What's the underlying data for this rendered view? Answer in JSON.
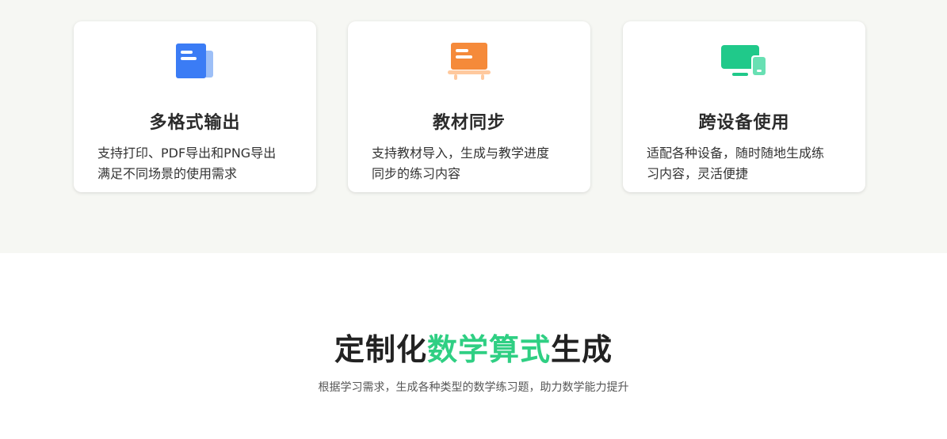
{
  "features": [
    {
      "icon": "document-copy-icon",
      "title": "多格式输出",
      "desc_lines": [
        "支持打印、PDF导出和PNG导出",
        "满足不同场景的使用需求"
      ]
    },
    {
      "icon": "blackboard-icon",
      "title": "教材同步",
      "desc_lines": [
        "支持教材导入，生成与教学进度",
        "同步的练习内容"
      ]
    },
    {
      "icon": "devices-icon",
      "title": "跨设备使用",
      "desc_lines": [
        "适配各种设备，随时随地生成练",
        "习内容，灵活便捷"
      ]
    }
  ],
  "section": {
    "title_pre": "定制化",
    "title_accent": "数学算式",
    "title_post": "生成",
    "subtitle": "根据学习需求，生成各种类型的数学练习题，助力数学能力提升"
  },
  "colors": {
    "accent": "#2fcf83",
    "blue": "#3b7cf5",
    "orange": "#f58a3a",
    "green": "#20c98a",
    "band": "#f6f7f3"
  }
}
